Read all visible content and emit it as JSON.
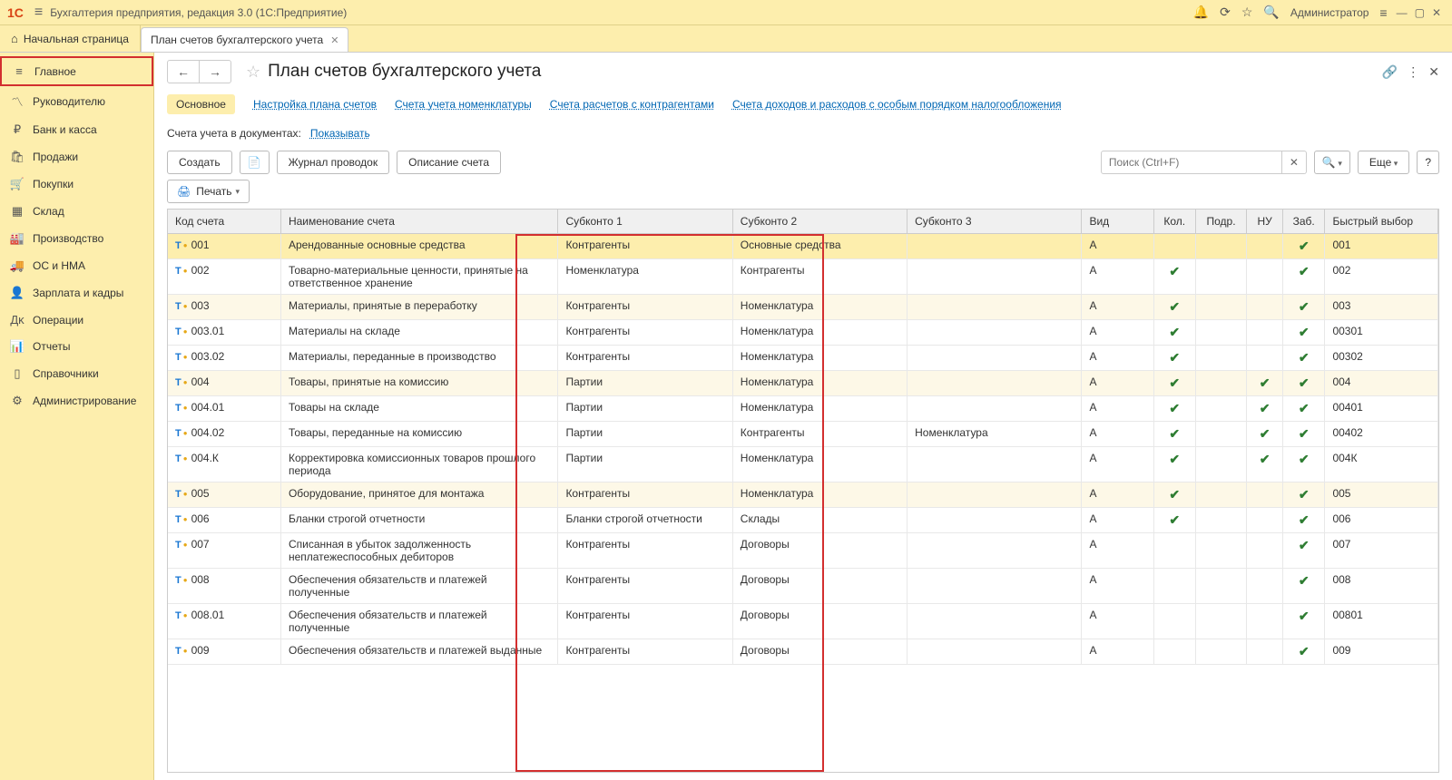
{
  "app_title": "Бухгалтерия предприятия, редакция 3.0  (1С:Предприятие)",
  "user_label": "Администратор",
  "home_tab": "Начальная страница",
  "tab1": {
    "label": "План счетов бухгалтерского учета"
  },
  "sidebar": {
    "items": [
      {
        "icon": "≡",
        "label": "Главное"
      },
      {
        "icon": "〽",
        "label": "Руководителю"
      },
      {
        "icon": "₽",
        "label": "Банк и касса"
      },
      {
        "icon": "🛍",
        "label": "Продажи"
      },
      {
        "icon": "🛒",
        "label": "Покупки"
      },
      {
        "icon": "▦",
        "label": "Склад"
      },
      {
        "icon": "🏭",
        "label": "Производство"
      },
      {
        "icon": "🚚",
        "label": "ОС и НМА"
      },
      {
        "icon": "👤",
        "label": "Зарплата и кадры"
      },
      {
        "icon": "Дᴋ",
        "label": "Операции"
      },
      {
        "icon": "📊",
        "label": "Отчеты"
      },
      {
        "icon": "▯",
        "label": "Справочники"
      },
      {
        "icon": "⚙",
        "label": "Администрирование"
      }
    ]
  },
  "page_title": "План счетов бухгалтерского учета",
  "link_tabs": {
    "t0": "Основное",
    "t1": "Настройка плана счетов",
    "t2": "Счета учета номенклатуры",
    "t3": "Счета расчетов с контрагентами",
    "t4": "Счета доходов и расходов с особым порядком налогообложения"
  },
  "setting_label": "Счета учета в документах:",
  "setting_link": "Показывать",
  "toolbar": {
    "create": "Создать",
    "journal": "Журнал проводок",
    "desc": "Описание счета",
    "search_placeholder": "Поиск (Ctrl+F)",
    "more": "Еще",
    "help": "?",
    "print": "Печать"
  },
  "columns": {
    "code": "Код счета",
    "name": "Наименование счета",
    "sub1": "Субконто 1",
    "sub2": "Субконто 2",
    "sub3": "Субконто 3",
    "vid": "Вид",
    "kol": "Кол.",
    "podr": "Подр.",
    "nu": "НУ",
    "zab": "Заб.",
    "fast": "Быстрый выбор"
  },
  "rows": [
    {
      "code": "001",
      "name": "Арендованные основные средства",
      "s1": "Контрагенты",
      "s2": "Основные средства",
      "s3": "",
      "vid": "А",
      "kol": false,
      "podr": false,
      "nu": false,
      "zab": true,
      "fast": "001",
      "sel": true
    },
    {
      "code": "002",
      "name": "Товарно-материальные ценности, принятые на ответственное хранение",
      "s1": "Номенклатура",
      "s2": "Контрагенты",
      "s3": "",
      "vid": "А",
      "kol": true,
      "podr": false,
      "nu": false,
      "zab": true,
      "fast": "002"
    },
    {
      "code": "003",
      "name": "Материалы, принятые в переработку",
      "s1": "Контрагенты",
      "s2": "Номенклатура",
      "s3": "",
      "vid": "А",
      "kol": true,
      "podr": false,
      "nu": false,
      "zab": true,
      "fast": "003",
      "alt": true
    },
    {
      "code": "003.01",
      "name": "Материалы на складе",
      "s1": "Контрагенты",
      "s2": "Номенклатура",
      "s3": "",
      "vid": "А",
      "kol": true,
      "podr": false,
      "nu": false,
      "zab": true,
      "fast": "00301"
    },
    {
      "code": "003.02",
      "name": "Материалы, переданные в производство",
      "s1": "Контрагенты",
      "s2": "Номенклатура",
      "s3": "",
      "vid": "А",
      "kol": true,
      "podr": false,
      "nu": false,
      "zab": true,
      "fast": "00302"
    },
    {
      "code": "004",
      "name": "Товары, принятые на комиссию",
      "s1": "Партии",
      "s2": "Номенклатура",
      "s3": "",
      "vid": "А",
      "kol": true,
      "podr": false,
      "nu": true,
      "zab": true,
      "fast": "004",
      "alt": true
    },
    {
      "code": "004.01",
      "name": "Товары на складе",
      "s1": "Партии",
      "s2": "Номенклатура",
      "s3": "",
      "vid": "А",
      "kol": true,
      "podr": false,
      "nu": true,
      "zab": true,
      "fast": "00401"
    },
    {
      "code": "004.02",
      "name": "Товары, переданные на комиссию",
      "s1": "Партии",
      "s2": "Контрагенты",
      "s3": "Номенклатура",
      "vid": "А",
      "kol": true,
      "podr": false,
      "nu": true,
      "zab": true,
      "fast": "00402"
    },
    {
      "code": "004.К",
      "name": "Корректировка комиссионных товаров прошлого периода",
      "s1": "Партии",
      "s2": "Номенклатура",
      "s3": "",
      "vid": "А",
      "kol": true,
      "podr": false,
      "nu": true,
      "zab": true,
      "fast": "004К"
    },
    {
      "code": "005",
      "name": "Оборудование, принятое для монтажа",
      "s1": "Контрагенты",
      "s2": "Номенклатура",
      "s3": "",
      "vid": "А",
      "kol": true,
      "podr": false,
      "nu": false,
      "zab": true,
      "fast": "005",
      "alt": true
    },
    {
      "code": "006",
      "name": "Бланки строгой отчетности",
      "s1": "Бланки строгой отчетности",
      "s2": "Склады",
      "s3": "",
      "vid": "А",
      "kol": true,
      "podr": false,
      "nu": false,
      "zab": true,
      "fast": "006"
    },
    {
      "code": "007",
      "name": "Списанная в убыток задолженность неплатежеспособных дебиторов",
      "s1": "Контрагенты",
      "s2": "Договоры",
      "s3": "",
      "vid": "А",
      "kol": false,
      "podr": false,
      "nu": false,
      "zab": true,
      "fast": "007"
    },
    {
      "code": "008",
      "name": "Обеспечения обязательств и платежей полученные",
      "s1": "Контрагенты",
      "s2": "Договоры",
      "s3": "",
      "vid": "А",
      "kol": false,
      "podr": false,
      "nu": false,
      "zab": true,
      "fast": "008"
    },
    {
      "code": "008.01",
      "name": "Обеспечения обязательств и платежей полученные",
      "s1": "Контрагенты",
      "s2": "Договоры",
      "s3": "",
      "vid": "А",
      "kol": false,
      "podr": false,
      "nu": false,
      "zab": true,
      "fast": "00801"
    },
    {
      "code": "009",
      "name": "Обеспечения обязательств и платежей выданные",
      "s1": "Контрагенты",
      "s2": "Договоры",
      "s3": "",
      "vid": "А",
      "kol": false,
      "podr": false,
      "nu": false,
      "zab": true,
      "fast": "009"
    }
  ]
}
